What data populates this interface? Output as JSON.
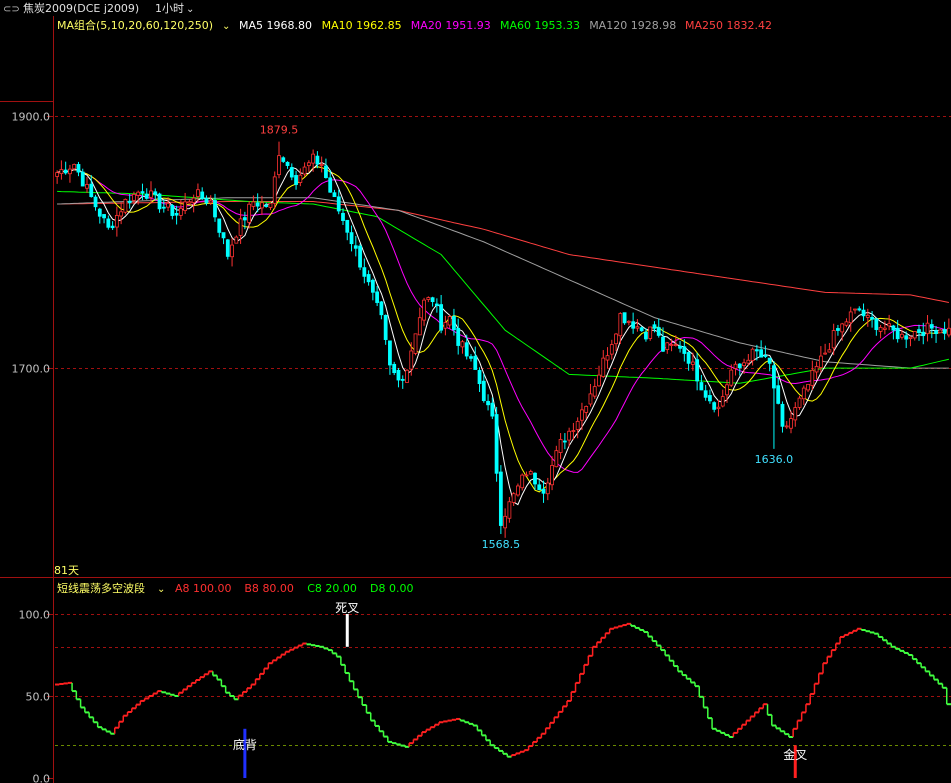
{
  "header": {
    "symbol": "焦炭2009(DCE j2009)",
    "period": "1小时"
  },
  "ma_legend": {
    "title": "MA组合(5,10,20,60,120,250)",
    "items": [
      {
        "name": "MA5",
        "value": "1968.80",
        "color": "#ffffff"
      },
      {
        "name": "MA10",
        "value": "1962.85",
        "color": "#ffff00"
      },
      {
        "name": "MA20",
        "value": "1951.93",
        "color": "#ff00ff"
      },
      {
        "name": "MA60",
        "value": "1953.33",
        "color": "#00ff00"
      },
      {
        "name": "MA120",
        "value": "1928.98",
        "color": "#a0a0a0"
      },
      {
        "name": "MA250",
        "value": "1832.42",
        "color": "#ff4040"
      }
    ]
  },
  "osc_legend": {
    "title": "短线震荡多空波段",
    "items": [
      {
        "name": "A8",
        "value": "100.00",
        "color": "#ff3030"
      },
      {
        "name": "B8",
        "value": "80.00",
        "color": "#ff3030"
      },
      {
        "name": "C8",
        "value": "20.00",
        "color": "#00ff00"
      },
      {
        "name": "D8",
        "value": "0.00",
        "color": "#00ff00"
      }
    ]
  },
  "footer_label": "81天",
  "colors": {
    "up": "#ff3232",
    "down": "#00ffff",
    "axis": "#8b0000",
    "grid": "#8b0000",
    "osc_up": "#ff2020",
    "osc_down": "#40ff40"
  },
  "chart_data": [
    {
      "type": "candlestick",
      "ylim": [
        1540,
        1960
      ],
      "yticks": [
        1700.0,
        1900.0
      ],
      "ytick_labels": [
        "1700.0",
        "1900.0"
      ],
      "annotations": [
        {
          "text": "1879.5",
          "x_index": 52,
          "value": 1879.5,
          "color": "#ff4040"
        },
        {
          "text": "1568.5",
          "x_index": 104,
          "value": 1568.5,
          "color": "#40e0ff"
        },
        {
          "text": "1636.0",
          "x_index": 168,
          "value": 1636.0,
          "color": "#40e0ff"
        }
      ],
      "price_path": [
        [
          0,
          1855
        ],
        [
          4,
          1862
        ],
        [
          8,
          1835
        ],
        [
          12,
          1810
        ],
        [
          16,
          1832
        ],
        [
          20,
          1842
        ],
        [
          24,
          1830
        ],
        [
          28,
          1822
        ],
        [
          32,
          1838
        ],
        [
          36,
          1832
        ],
        [
          40,
          1790
        ],
        [
          42,
          1808
        ],
        [
          46,
          1832
        ],
        [
          50,
          1828
        ],
        [
          52,
          1872
        ],
        [
          56,
          1850
        ],
        [
          60,
          1865
        ],
        [
          62,
          1862
        ],
        [
          64,
          1840
        ],
        [
          68,
          1810
        ],
        [
          72,
          1775
        ],
        [
          76,
          1738
        ],
        [
          78,
          1700
        ],
        [
          80,
          1690
        ],
        [
          82,
          1700
        ],
        [
          84,
          1730
        ],
        [
          86,
          1752
        ],
        [
          88,
          1755
        ],
        [
          90,
          1735
        ],
        [
          92,
          1740
        ],
        [
          94,
          1722
        ],
        [
          98,
          1698
        ],
        [
          102,
          1658
        ],
        [
          104,
          1580
        ],
        [
          106,
          1592
        ],
        [
          110,
          1618
        ],
        [
          114,
          1605
        ],
        [
          118,
          1640
        ],
        [
          122,
          1660
        ],
        [
          126,
          1688
        ],
        [
          130,
          1722
        ],
        [
          132,
          1742
        ],
        [
          134,
          1738
        ],
        [
          138,
          1728
        ],
        [
          140,
          1732
        ],
        [
          142,
          1715
        ],
        [
          146,
          1718
        ],
        [
          148,
          1708
        ],
        [
          152,
          1680
        ],
        [
          155,
          1668
        ],
        [
          158,
          1698
        ],
        [
          160,
          1700
        ],
        [
          162,
          1710
        ],
        [
          164,
          1712
        ],
        [
          167,
          1702
        ],
        [
          170,
          1650
        ],
        [
          172,
          1660
        ],
        [
          175,
          1680
        ],
        [
          178,
          1700
        ],
        [
          182,
          1725
        ],
        [
          186,
          1742
        ],
        [
          188,
          1746
        ],
        [
          190,
          1738
        ],
        [
          194,
          1732
        ],
        [
          198,
          1725
        ],
        [
          202,
          1730
        ],
        [
          206,
          1732
        ],
        [
          209,
          1730
        ]
      ],
      "ma_paths": {
        "MA60": [
          [
            0,
            1840
          ],
          [
            20,
            1838
          ],
          [
            45,
            1832
          ],
          [
            60,
            1830
          ],
          [
            75,
            1820
          ],
          [
            90,
            1790
          ],
          [
            105,
            1730
          ],
          [
            120,
            1695
          ],
          [
            140,
            1692
          ],
          [
            160,
            1688
          ],
          [
            180,
            1700
          ],
          [
            200,
            1700
          ],
          [
            209,
            1707
          ]
        ],
        "MA120": [
          [
            0,
            1830
          ],
          [
            40,
            1835
          ],
          [
            60,
            1835
          ],
          [
            80,
            1825
          ],
          [
            100,
            1800
          ],
          [
            120,
            1770
          ],
          [
            140,
            1740
          ],
          [
            160,
            1720
          ],
          [
            180,
            1705
          ],
          [
            200,
            1700
          ],
          [
            209,
            1700
          ]
        ],
        "MA250": [
          [
            0,
            1830
          ],
          [
            40,
            1832
          ],
          [
            60,
            1832
          ],
          [
            80,
            1825
          ],
          [
            100,
            1810
          ],
          [
            120,
            1790
          ],
          [
            140,
            1780
          ],
          [
            160,
            1770
          ],
          [
            180,
            1760
          ],
          [
            200,
            1758
          ],
          [
            209,
            1752
          ]
        ]
      }
    },
    {
      "type": "line",
      "ylim": [
        0,
        100
      ],
      "yticks": [
        0,
        50,
        100
      ],
      "ytick_labels": [
        "0.0",
        "50.0",
        "100.0"
      ],
      "reference_lines": [
        100,
        80,
        50,
        20
      ],
      "series": {
        "points": [
          [
            0,
            57
          ],
          [
            3,
            58
          ],
          [
            6,
            43
          ],
          [
            10,
            31
          ],
          [
            13,
            27
          ],
          [
            16,
            38
          ],
          [
            20,
            47
          ],
          [
            24,
            53
          ],
          [
            28,
            50
          ],
          [
            32,
            58
          ],
          [
            36,
            65
          ],
          [
            38,
            60
          ],
          [
            40,
            52
          ],
          [
            42,
            48
          ],
          [
            46,
            57
          ],
          [
            50,
            70
          ],
          [
            54,
            77
          ],
          [
            58,
            82
          ],
          [
            62,
            80
          ],
          [
            64,
            78
          ],
          [
            66,
            74
          ],
          [
            70,
            54
          ],
          [
            74,
            35
          ],
          [
            78,
            22
          ],
          [
            82,
            19
          ],
          [
            86,
            28
          ],
          [
            90,
            34
          ],
          [
            94,
            36
          ],
          [
            98,
            32
          ],
          [
            102,
            20
          ],
          [
            106,
            13
          ],
          [
            110,
            17
          ],
          [
            114,
            27
          ],
          [
            120,
            47
          ],
          [
            126,
            80
          ],
          [
            130,
            91
          ],
          [
            134,
            94
          ],
          [
            138,
            89
          ],
          [
            142,
            78
          ],
          [
            146,
            65
          ],
          [
            150,
            56
          ],
          [
            154,
            30
          ],
          [
            158,
            25
          ],
          [
            162,
            35
          ],
          [
            166,
            45
          ],
          [
            168,
            32
          ],
          [
            172,
            25
          ],
          [
            176,
            45
          ],
          [
            180,
            70
          ],
          [
            184,
            86
          ],
          [
            188,
            91
          ],
          [
            192,
            88
          ],
          [
            196,
            80
          ],
          [
            200,
            75
          ],
          [
            204,
            65
          ],
          [
            208,
            55
          ],
          [
            209,
            45
          ]
        ]
      },
      "signals": [
        {
          "text": "死叉",
          "x_index": 68,
          "value": 100,
          "bar_to": 80,
          "color": "#ffffff"
        },
        {
          "text": "底背",
          "x_index": 44,
          "value": 30,
          "bar_to": 0,
          "color": "#2030ff"
        },
        {
          "text": "金叉",
          "x_index": 173,
          "value": 20,
          "bar_to": 0,
          "color": "#ff2020"
        }
      ]
    }
  ]
}
